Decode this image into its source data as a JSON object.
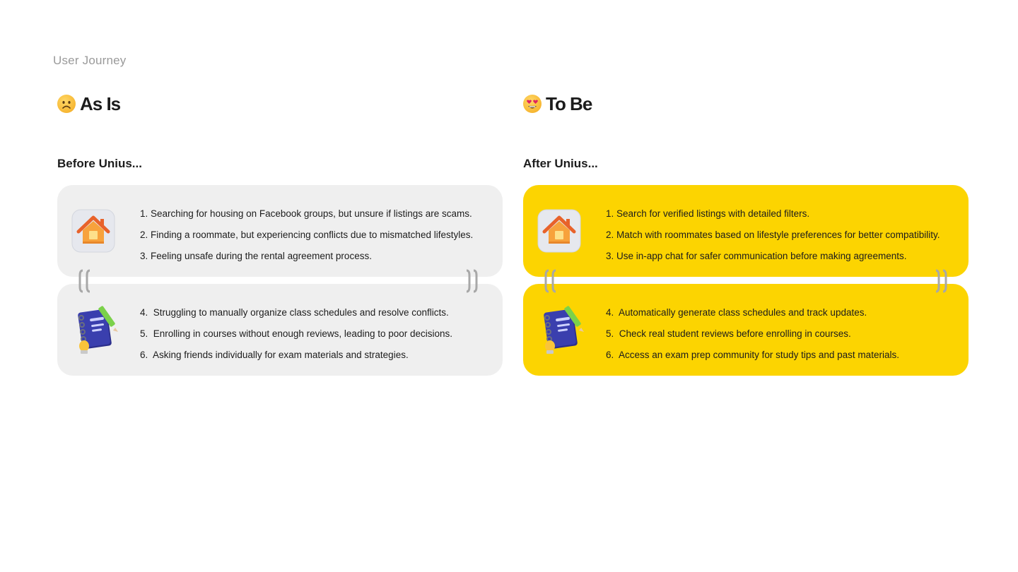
{
  "page": {
    "eyebrow": "User Journey"
  },
  "as_is": {
    "emoji_icon": "frowning-face-icon",
    "title": "As Is",
    "subtitle": "Before Unius...",
    "card_top": {
      "icon": "house-app-icon",
      "items": [
        "1. Searching for housing on Facebook groups, but unsure if listings are scams.",
        "2. Finding a roommate, but experiencing conflicts due to mismatched lifestyles.",
        "3. Feeling unsafe during the rental agreement process."
      ]
    },
    "card_bottom": {
      "icon": "notebook-pencil-icon",
      "items": [
        {
          "num": "4.",
          "text": "Struggling to manually organize class schedules and resolve conflicts."
        },
        {
          "num": "5.",
          "text": "Enrolling in courses without enough reviews, leading to poor decisions."
        },
        {
          "num": "6.",
          "text": "Asking friends individually for exam materials and strategies."
        }
      ]
    }
  },
  "to_be": {
    "emoji_icon": "heart-eyes-face-icon",
    "title": "To Be",
    "subtitle": "After Unius...",
    "card_top": {
      "icon": "house-app-icon",
      "items": [
        "1. Search for verified listings with detailed filters.",
        "2. Match with roommates based on lifestyle preferences for better compatibility.",
        "3. Use in-app chat for safer communication before making agreements."
      ]
    },
    "card_bottom": {
      "icon": "notebook-pencil-icon",
      "items": [
        {
          "num": "4.",
          "text": "Automatically generate class schedules and track updates."
        },
        {
          "num": "5.",
          "text": "Check real student reviews before enrolling in courses."
        },
        {
          "num": "6.",
          "text": "Access an exam prep community for study tips and past materials."
        }
      ]
    }
  },
  "colors": {
    "as_is_card": "#efefef",
    "to_be_card": "#fcd401",
    "eyebrow": "#9a9a9a"
  }
}
